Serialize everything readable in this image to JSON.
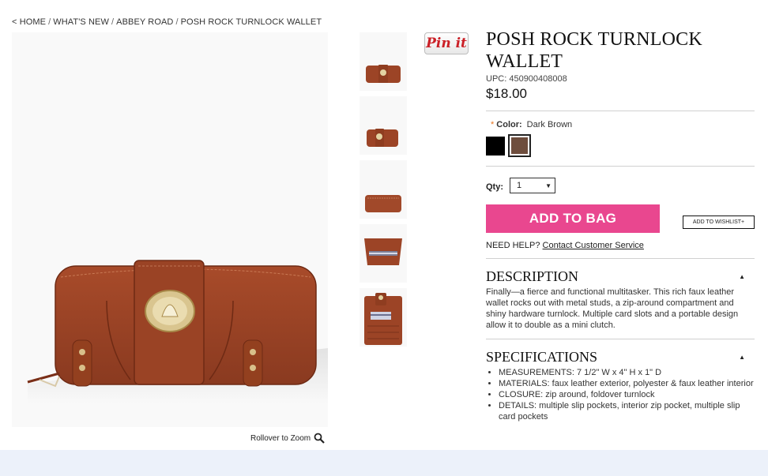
{
  "breadcrumb": {
    "back": "<",
    "items": [
      "HOME",
      "WHAT'S NEW",
      "ABBEY ROAD",
      "POSH ROCK TURNLOCK WALLET"
    ]
  },
  "zoom_hint": "Rollover to Zoom",
  "pinit_label": "Pin it",
  "product": {
    "title": "POSH ROCK TURNLOCK WALLET",
    "upc": "UPC: 450900408008",
    "price": "$18.00",
    "color_label": "Color:",
    "color_required": "*",
    "color_value": "Dark Brown",
    "swatches": [
      {
        "name": "Black",
        "hex": "#000000"
      },
      {
        "name": "Dark Brown",
        "hex": "#6e4d3d"
      }
    ],
    "qty_label": "Qty:",
    "qty_value": "1",
    "add_to_bag": "ADD TO BAG",
    "add_to_wishlist": "ADD TO WISHLIST+",
    "help_text": "NEED HELP?",
    "help_link": "Contact Customer Service"
  },
  "description": {
    "title": "DESCRIPTION",
    "text": "Finally—a fierce and functional multitasker. This rich faux leather wallet rocks out with metal studs, a zip-around compartment and shiny hardware turnlock. Multiple card slots and a portable design allow it to double as a mini clutch."
  },
  "specifications": {
    "title": "SPECIFICATIONS",
    "items": [
      "MEASUREMENTS: 7 1/2\" W x 4\" H x 1\" D",
      "MATERIALS: faux leather exterior, polyester & faux leather interior",
      "CLOSURE: zip around, foldover turnlock",
      "DETAILS: multiple slip pockets, interior zip pocket, multiple slip card pockets"
    ]
  },
  "colors": {
    "accent_pink": "#e9478f",
    "wallet_brown": "#9c4426",
    "footer_band": "#ecf1fa"
  }
}
